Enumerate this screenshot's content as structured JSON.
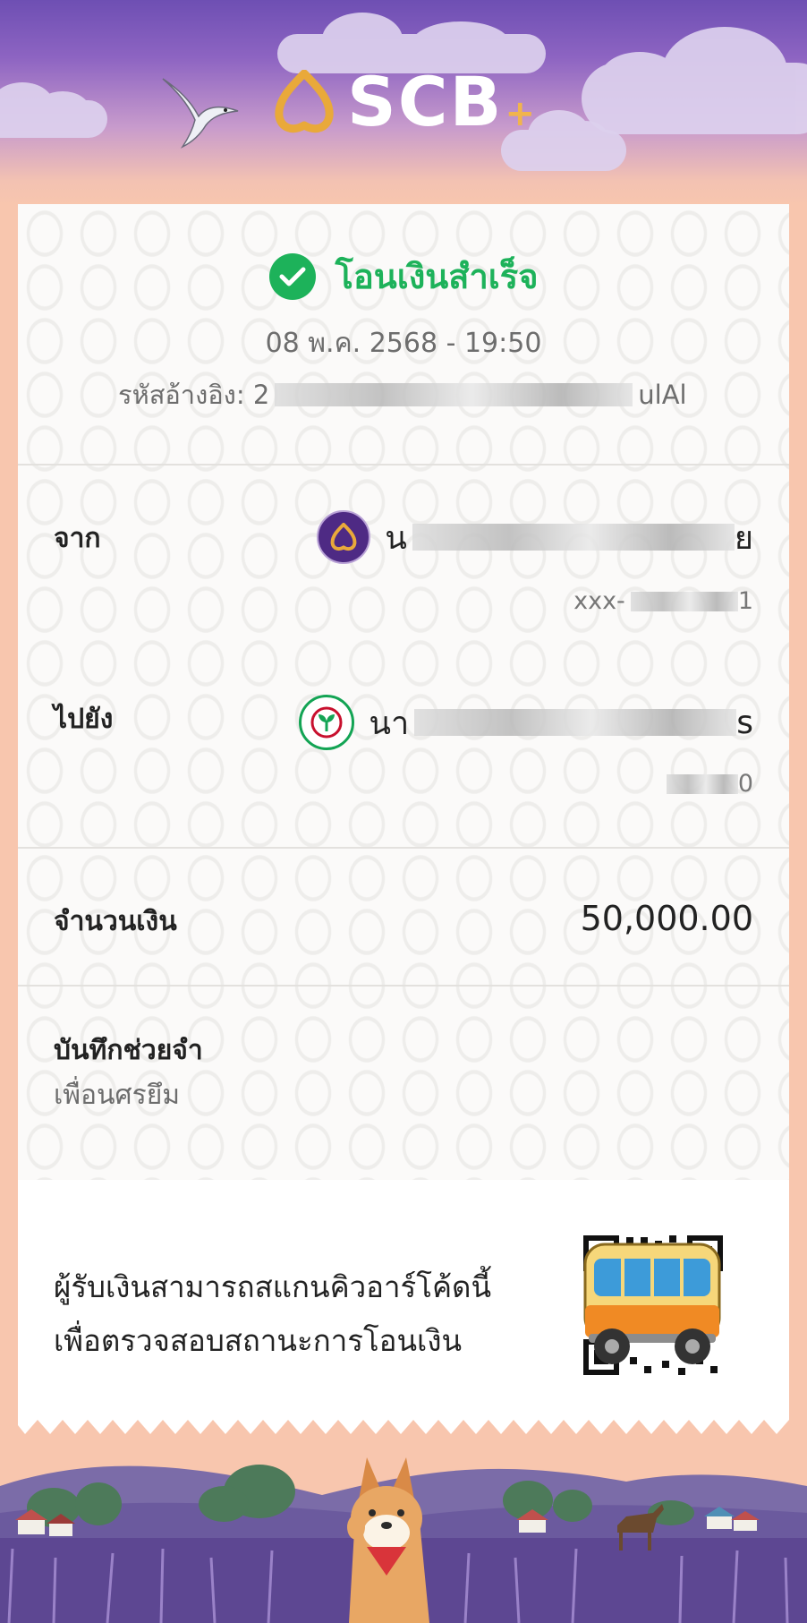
{
  "brand": {
    "logo_text": "SCB",
    "logo_plus": "+",
    "accent": "#4e2a84",
    "success": "#1db25a"
  },
  "status": {
    "text": "โอนเงินสำเร็จ",
    "icon": "check-circle-icon"
  },
  "datetime": "08 พ.ค. 2568 - 19:50",
  "reference": {
    "label": "รหัสอ้างอิง: 2",
    "value_visible": "2",
    "value_tail": "ulAl"
  },
  "from": {
    "label": "จาก",
    "name_visible": "น",
    "name_tail": "ย",
    "account_prefix": "xxx-",
    "account_tail": "1",
    "bank_icon": "scb-bank-icon"
  },
  "to": {
    "label": "ไปยัง",
    "name_visible": "นา",
    "name_tail": "s",
    "account_tail": "0",
    "bank_icon": "kbank-icon"
  },
  "amount": {
    "label": "จำนวนเงิน",
    "value": "50,000.00"
  },
  "memo": {
    "label": "บันทึกช่วยจำ",
    "value": "เพื่อนศรยึม"
  },
  "qr": {
    "line1": "ผู้รับเงินสามารถสแกนคิวอาร์โค้ดนี้",
    "line2": "เพื่อตรวจสอบสถานะการโอนเงิน",
    "overlay_icon": "bus-icon"
  }
}
